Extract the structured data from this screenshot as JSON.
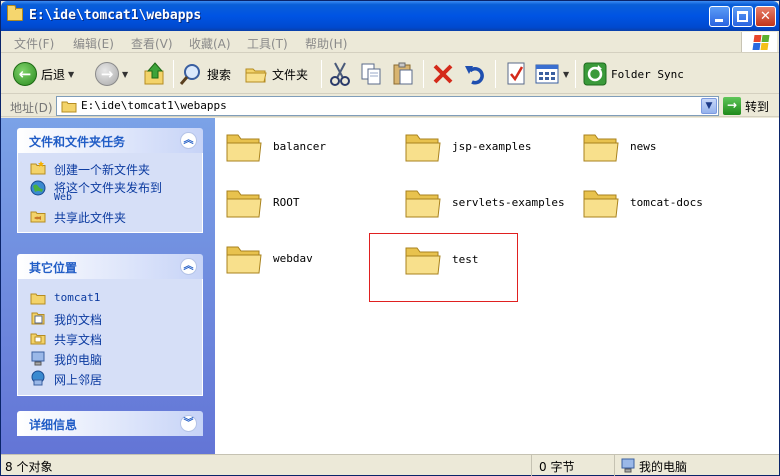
{
  "window": {
    "title": "E:\\ide\\tomcat1\\webapps"
  },
  "menu": [
    "文件(F)",
    "编辑(E)",
    "查看(V)",
    "收藏(A)",
    "工具(T)",
    "帮助(H)"
  ],
  "toolbar": {
    "back": "后退",
    "search": "搜索",
    "folders": "文件夹",
    "folder_sync": "Folder Sync"
  },
  "address": {
    "label": "地址(D)",
    "path": "E:\\ide\\tomcat1\\webapps",
    "go": "转到"
  },
  "tasks": {
    "file_tasks": {
      "title": "文件和文件夹任务",
      "items": [
        "创建一个新文件夹",
        "将这个文件夹发布到",
        "Web",
        "共享此文件夹"
      ]
    },
    "other_places": {
      "title": "其它位置",
      "items": [
        "tomcat1",
        "我的文档",
        "共享文档",
        "我的电脑",
        "网上邻居"
      ]
    },
    "details": {
      "title": "详细信息"
    }
  },
  "folders": [
    "balancer",
    "jsp-examples",
    "news",
    "ROOT",
    "servlets-examples",
    "tomcat-docs",
    "webdav",
    "test"
  ],
  "status": {
    "objects": "8 个对象",
    "size": "0 字节",
    "location": "我的电脑"
  },
  "colors": {
    "title_bar": "#0054e3",
    "task_pane": "#7ba2e7",
    "highlight": "#e02020"
  }
}
